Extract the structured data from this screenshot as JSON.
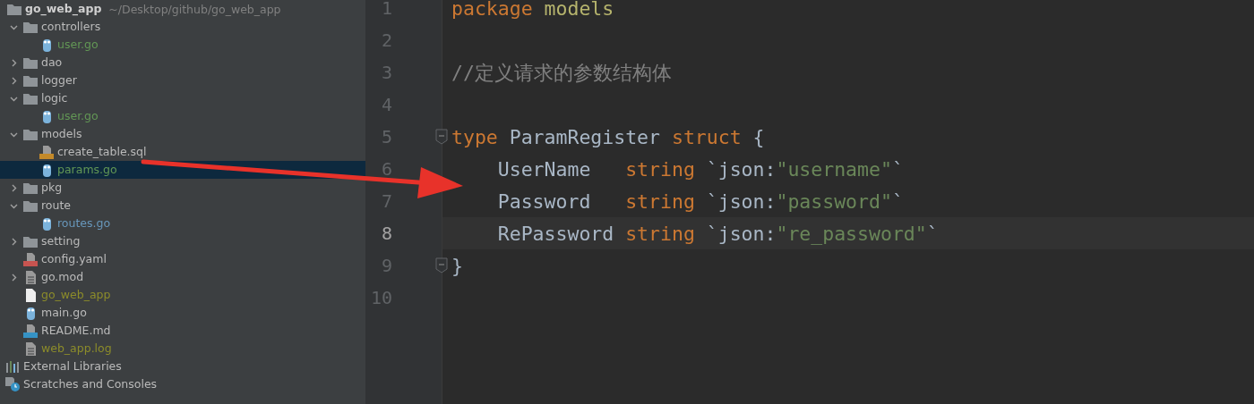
{
  "project_tree": {
    "root": {
      "name": "go_web_app",
      "path": "~/Desktop/github/go_web_app",
      "kind": "folder",
      "color": "#d0d0d0",
      "children": [
        {
          "name": "controllers",
          "kind": "folder",
          "color": "#bbbbbb",
          "expanded": true,
          "children": [
            {
              "name": "user.go",
              "kind": "go",
              "color": "#629755",
              "selected": false
            }
          ]
        },
        {
          "name": "dao",
          "kind": "folder",
          "color": "#bbbbbb",
          "expanded": false
        },
        {
          "name": "logger",
          "kind": "folder",
          "color": "#bbbbbb",
          "expanded": false
        },
        {
          "name": "logic",
          "kind": "folder",
          "color": "#bbbbbb",
          "expanded": true,
          "children": [
            {
              "name": "user.go",
              "kind": "go",
              "color": "#629755",
              "selected": false
            }
          ]
        },
        {
          "name": "models",
          "kind": "folder",
          "color": "#bbbbbb",
          "expanded": true,
          "children": [
            {
              "name": "create_table.sql",
              "kind": "sql",
              "color": "#bbbbbb",
              "selected": false
            },
            {
              "name": "params.go",
              "kind": "go",
              "color": "#629755",
              "selected": true
            }
          ]
        },
        {
          "name": "pkg",
          "kind": "folder",
          "color": "#bbbbbb",
          "expanded": false
        },
        {
          "name": "route",
          "kind": "folder",
          "color": "#bbbbbb",
          "expanded": true,
          "children": [
            {
              "name": "routes.go",
              "kind": "go",
              "color": "#6897bb",
              "selected": false
            }
          ]
        },
        {
          "name": "setting",
          "kind": "folder",
          "color": "#bbbbbb",
          "expanded": false
        },
        {
          "name": "config.yaml",
          "kind": "yaml",
          "color": "#bbbbbb",
          "selected": false
        },
        {
          "name": "go.mod",
          "kind": "text",
          "color": "#bbbbbb",
          "expanded": false
        },
        {
          "name": "go_web_app",
          "kind": "binary",
          "color": "#8c8c2a",
          "selected": false
        },
        {
          "name": "main.go",
          "kind": "go",
          "color": "#bbbbbb",
          "selected": false
        },
        {
          "name": "README.md",
          "kind": "md",
          "color": "#bbbbbb",
          "selected": false
        },
        {
          "name": "web_app.log",
          "kind": "text",
          "color": "#8c8c2a",
          "selected": false
        }
      ]
    },
    "extras": [
      {
        "name": "External Libraries",
        "kind": "libraries"
      },
      {
        "name": "Scratches and Consoles",
        "kind": "scratches"
      }
    ]
  },
  "editor": {
    "lines": [
      {
        "number": "1",
        "current": false,
        "tokens": [
          {
            "kind": "keyword",
            "text": "package"
          },
          {
            "kind": "package",
            "text": " models"
          }
        ]
      },
      {
        "number": "2",
        "current": false
      },
      {
        "number": "3",
        "current": false,
        "tokens": [
          {
            "kind": "comment",
            "text": "//定义请求的参数结构体"
          }
        ]
      },
      {
        "number": "4",
        "current": false
      },
      {
        "number": "5",
        "current": false,
        "fold": true,
        "tokens": [
          {
            "kind": "keyword",
            "text": "type"
          },
          {
            "kind": "plain",
            "text": " ParamRegister "
          },
          {
            "kind": "keyword",
            "text": "struct"
          },
          {
            "kind": "plain",
            "text": " {"
          }
        ]
      },
      {
        "number": "6",
        "current": false,
        "tokens": [
          {
            "kind": "plain",
            "text": "    UserName   "
          },
          {
            "kind": "keyword",
            "text": "string"
          },
          {
            "kind": "plain",
            "text": " `json:"
          },
          {
            "kind": "string",
            "text": "\"username\""
          },
          {
            "kind": "plain",
            "text": "`"
          }
        ]
      },
      {
        "number": "7",
        "current": false,
        "tokens": [
          {
            "kind": "plain",
            "text": "    Password   "
          },
          {
            "kind": "keyword",
            "text": "string"
          },
          {
            "kind": "plain",
            "text": " `json:"
          },
          {
            "kind": "string",
            "text": "\"password\""
          },
          {
            "kind": "plain",
            "text": "`"
          }
        ]
      },
      {
        "number": "8",
        "current": true,
        "tokens": [
          {
            "kind": "plain",
            "text": "    RePassword "
          },
          {
            "kind": "keyword",
            "text": "string"
          },
          {
            "kind": "plain",
            "text": " `json:"
          },
          {
            "kind": "string",
            "text": "\"re_password\""
          },
          {
            "kind": "plain",
            "text": "`"
          }
        ]
      },
      {
        "number": "9",
        "current": false,
        "fold": true,
        "tokens": [
          {
            "kind": "plain",
            "text": "}"
          }
        ]
      },
      {
        "number": "10",
        "current": false
      }
    ]
  }
}
